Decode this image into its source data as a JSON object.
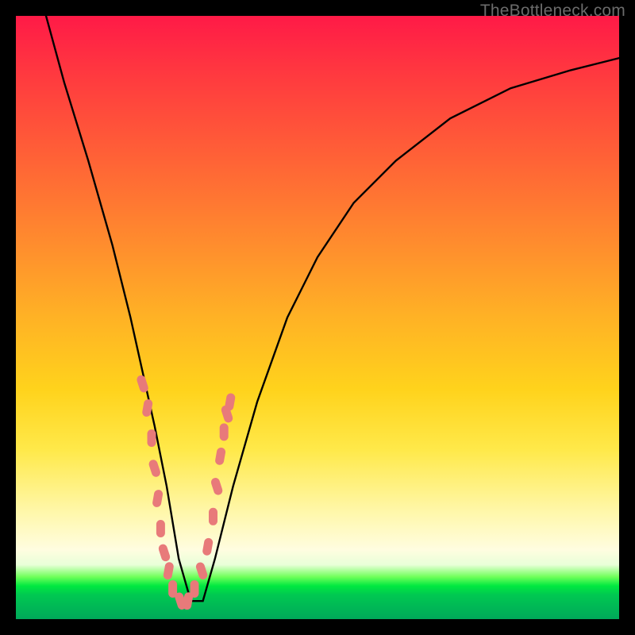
{
  "watermark": "TheBottleneck.com",
  "colors": {
    "frame": "#000000",
    "gradient_top": "#ff1a47",
    "gradient_mid": "#ffe94a",
    "gradient_bottom": "#00a85a",
    "curve": "#000000",
    "marker": "#e87a7a"
  },
  "chart_data": {
    "type": "line",
    "title": "",
    "xlabel": "",
    "ylabel": "",
    "xlim": [
      0,
      100
    ],
    "ylim": [
      0,
      100
    ],
    "series": [
      {
        "name": "bottleneck-curve",
        "x": [
          5,
          8,
          12,
          16,
          19,
          21,
          23,
          25,
          27,
          29,
          31,
          33,
          36,
          40,
          45,
          50,
          56,
          63,
          72,
          82,
          92,
          100
        ],
        "y_pct": [
          100,
          89,
          76,
          62,
          50,
          41,
          32,
          22,
          10,
          3,
          3,
          10,
          22,
          36,
          50,
          60,
          69,
          76,
          83,
          88,
          91,
          93
        ]
      }
    ],
    "markers": {
      "name": "highlight-points-near-min",
      "x": [
        21.0,
        21.8,
        22.5,
        23.0,
        23.5,
        24.0,
        24.6,
        25.3,
        26.0,
        27.3,
        28.5,
        29.6,
        30.8,
        31.8,
        32.7,
        33.3,
        33.9,
        34.5,
        35.0,
        35.5
      ],
      "y_pct": [
        39,
        35,
        30,
        25,
        20,
        15,
        11,
        8,
        5,
        3,
        3,
        5,
        8,
        12,
        17,
        22,
        27,
        31,
        34,
        36
      ]
    },
    "min_point": {
      "x": 29,
      "y_pct": 3
    }
  }
}
